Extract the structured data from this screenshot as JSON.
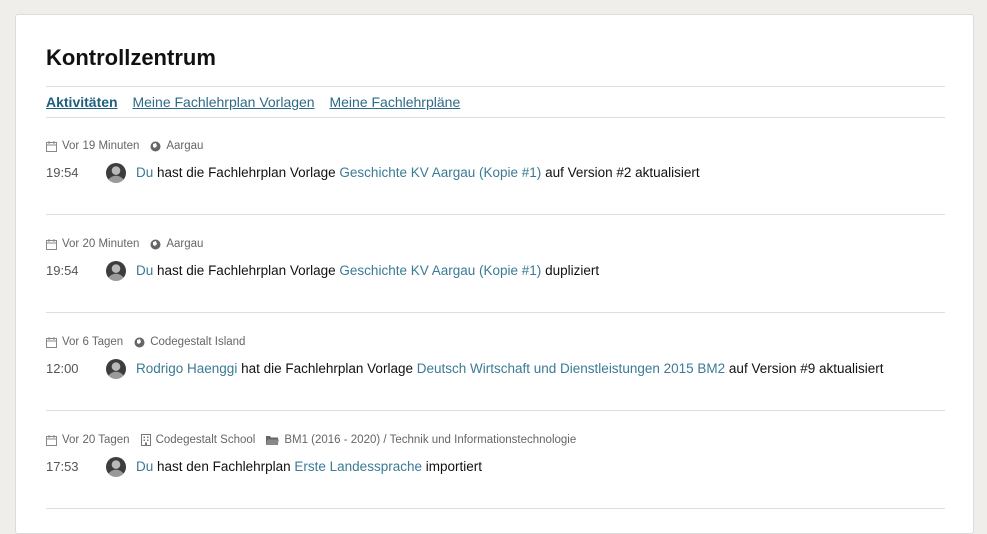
{
  "page": {
    "title": "Kontrollzentrum"
  },
  "tabs": [
    {
      "label": "Aktivitäten"
    },
    {
      "label": "Meine Fachlehrplan Vorlagen"
    },
    {
      "label": "Meine Fachlehrpläne"
    }
  ],
  "activities": [
    {
      "ago": "Vor 19 Minuten",
      "location": "Aargau",
      "time": "19:54",
      "actor": "Du",
      "text1": "hast die Fachlehrplan Vorlage",
      "object": "Geschichte KV Aargau (Kopie #1)",
      "text2": "auf Version #2 aktualisiert"
    },
    {
      "ago": "Vor 20 Minuten",
      "location": "Aargau",
      "time": "19:54",
      "actor": "Du",
      "text1": "hast die Fachlehrplan Vorlage",
      "object": "Geschichte KV Aargau (Kopie #1)",
      "text2": "dupliziert"
    },
    {
      "ago": "Vor 6 Tagen",
      "location": "Codegestalt Island",
      "time": "12:00",
      "actor": "Rodrigo Haenggi",
      "text1": "hat die Fachlehrplan Vorlage",
      "object": "Deutsch Wirtschaft und Dienstleistungen 2015 BM2",
      "text2": "auf Version #9 aktualisiert"
    },
    {
      "ago": "Vor 20 Tagen",
      "school": "Codegestalt School",
      "folder": "BM1 (2016 - 2020) / Technik und Informationstechnologie",
      "time": "17:53",
      "actor": "Du",
      "text1": "hast den Fachlehrplan",
      "object": "Erste Landessprache",
      "text2": "importiert"
    }
  ],
  "colors": {
    "link": "#3b7a96",
    "tab_active": "#1f5e7d",
    "background": "#efeeea"
  },
  "icons": [
    "calendar-icon",
    "globe-icon",
    "building-icon",
    "folder-icon",
    "avatar"
  ]
}
